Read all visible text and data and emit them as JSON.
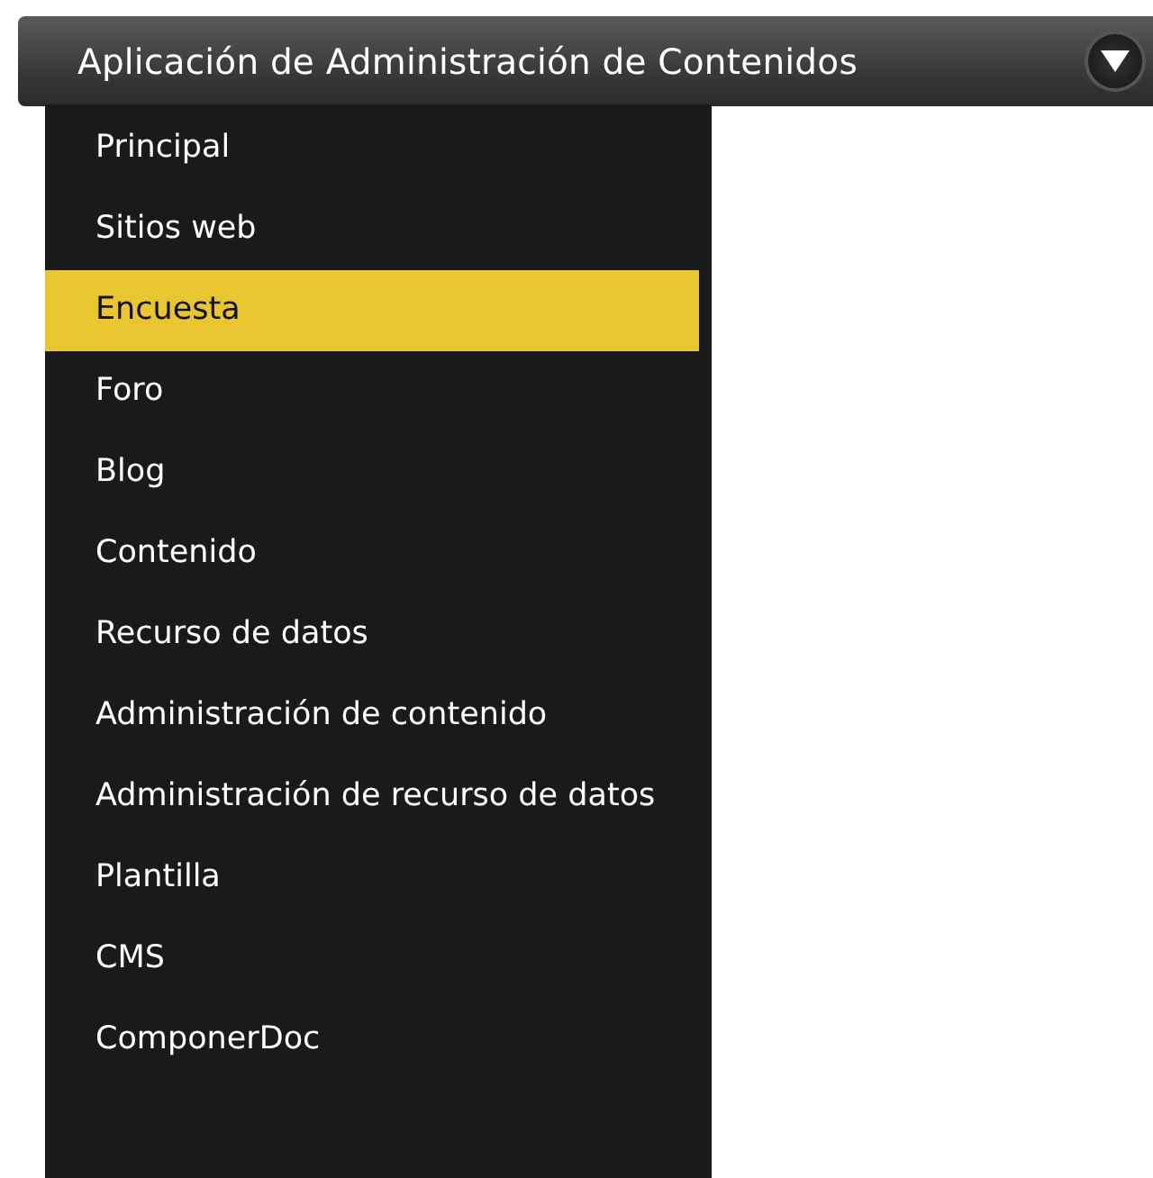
{
  "header": {
    "title": "Aplicación de Administración de Contenidos"
  },
  "menu": {
    "items": [
      {
        "label": "Principal",
        "selected": false
      },
      {
        "label": "Sitios web",
        "selected": false
      },
      {
        "label": "Encuesta",
        "selected": true
      },
      {
        "label": "Foro",
        "selected": false
      },
      {
        "label": "Blog",
        "selected": false
      },
      {
        "label": "Contenido",
        "selected": false
      },
      {
        "label": "Recurso de datos",
        "selected": false
      },
      {
        "label": "Administración de contenido",
        "selected": false
      },
      {
        "label": "Administración de recurso de datos",
        "selected": false
      },
      {
        "label": "Plantilla",
        "selected": false
      },
      {
        "label": "CMS",
        "selected": false
      },
      {
        "label": "ComponerDoc",
        "selected": false
      }
    ]
  }
}
